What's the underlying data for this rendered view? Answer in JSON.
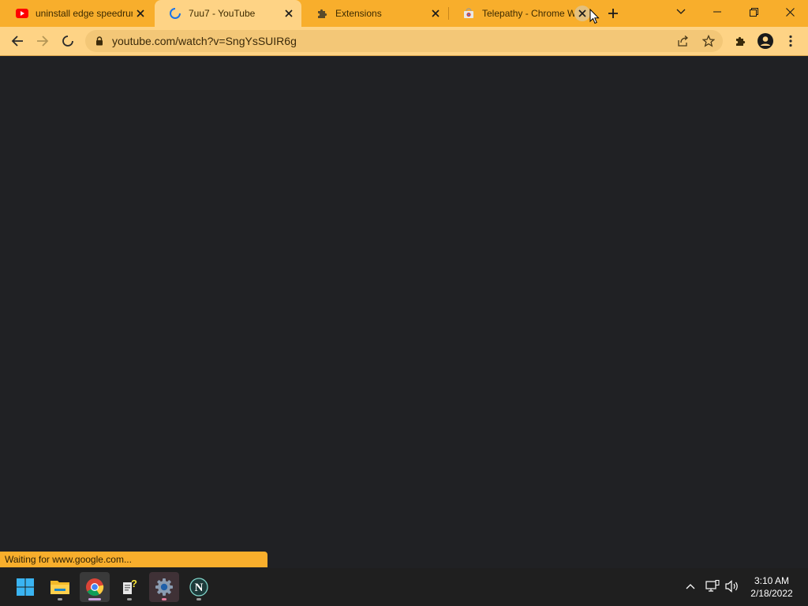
{
  "tabs": [
    {
      "title": "uninstall edge speedrun",
      "icon": "youtube-icon"
    },
    {
      "title": "7uu7 - YouTube",
      "icon": "loading-spinner-icon"
    },
    {
      "title": "Extensions",
      "icon": "puzzle-icon"
    },
    {
      "title": "Telepathy - Chrome Web Store",
      "icon": "chrome-web-store-icon"
    }
  ],
  "address_bar": {
    "url": "youtube.com/watch?v=SngYsSUIR6g"
  },
  "status_bar": {
    "text": "Waiting for www.google.com..."
  },
  "taskbar": {
    "apps": [
      "start-button",
      "file-explorer",
      "google-chrome",
      "help-app",
      "settings",
      "notion"
    ],
    "clock": {
      "time": "3:10 AM",
      "date": "2/18/2022"
    }
  },
  "colors": {
    "theme_frame": "#f8ae2c",
    "theme_toolbar": "#fed385",
    "page_background": "#202124",
    "taskbar": "#1f1f1f"
  }
}
